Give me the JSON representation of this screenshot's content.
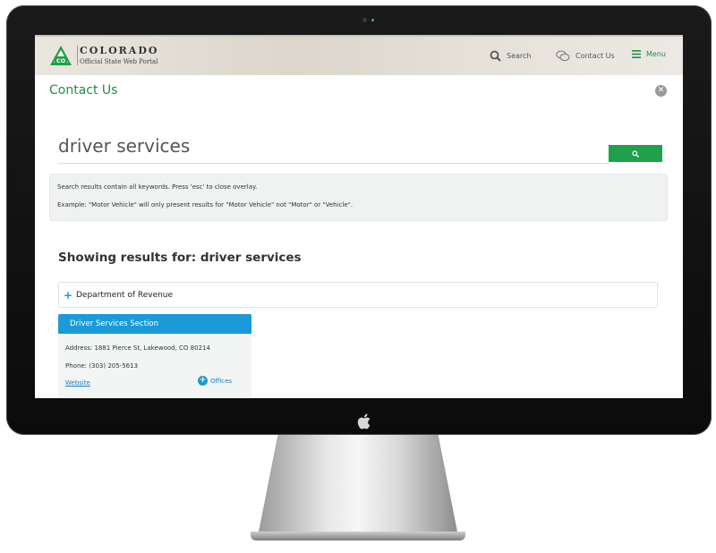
{
  "header": {
    "brand_title": "COLORADO",
    "brand_subtitle": "Official State Web Portal",
    "logo_text": "CO",
    "nav": {
      "search": "Search",
      "contact": "Contact Us",
      "menu": "Menu"
    }
  },
  "overlay": {
    "title": "Contact Us",
    "close_icon": "close-icon"
  },
  "search": {
    "value": "driver services"
  },
  "notice": {
    "line1": "Search results contain all keywords. Press 'esc' to close overlay.",
    "line2": "Example: \"Motor Vehicle\" will only present results for \"Motor Vehicle\" not \"Motor\" or \"Vehicle\"."
  },
  "results": {
    "heading": "Showing results for: driver services",
    "accordion_label": "Department of Revenue",
    "card": {
      "title": "Driver Services Section",
      "address": "Address: 1881 Pierce St, Lakewood, CO 80214",
      "phone": "Phone: (303) 205-5613",
      "website": "Website",
      "offices": "Offices"
    }
  },
  "colors": {
    "accent_green": "#1e8f3e",
    "button_green": "#1ea14a",
    "accent_blue": "#1a9bd7"
  }
}
